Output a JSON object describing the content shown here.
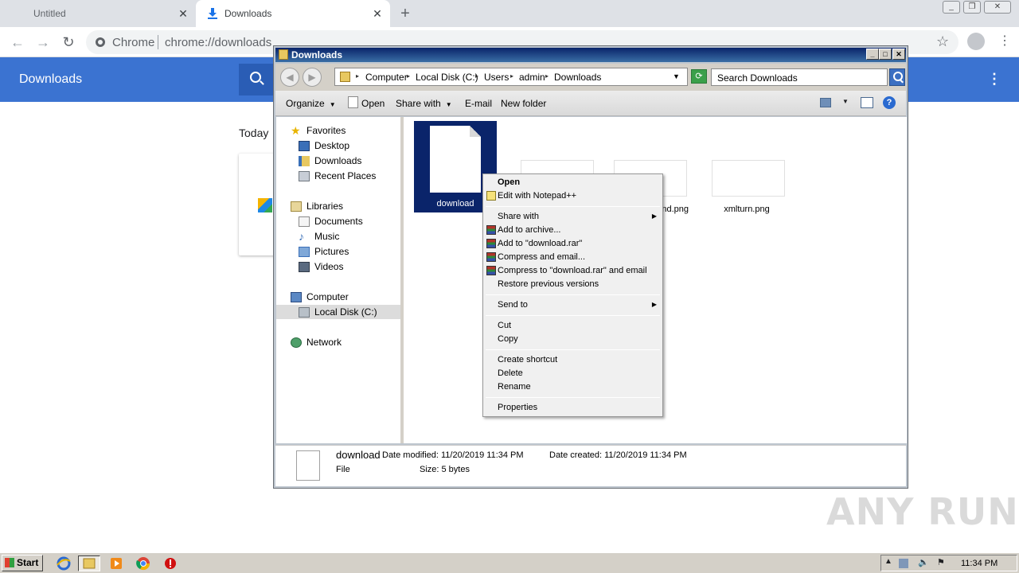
{
  "browser": {
    "tabs": [
      {
        "title": "Untitled"
      },
      {
        "title": "Downloads"
      }
    ],
    "omnibox": {
      "site": "Chrome",
      "url": "chrome://downloads"
    },
    "page": {
      "title": "Downloads",
      "date_group": "Today"
    }
  },
  "explorer": {
    "title": "Downloads",
    "breadcrumb": [
      "Computer",
      "Local Disk (C:)",
      "Users",
      "admin",
      "Downloads"
    ],
    "search_placeholder": "Search Downloads",
    "commands": {
      "organize": "Organize",
      "open": "Open",
      "share_with": "Share with",
      "email": "E-mail",
      "new_folder": "New folder"
    },
    "nav": {
      "favorites": "Favorites",
      "desktop": "Desktop",
      "downloads": "Downloads",
      "recent": "Recent Places",
      "libraries": "Libraries",
      "documents": "Documents",
      "music": "Music",
      "pictures": "Pictures",
      "videos": "Videos",
      "computer": "Computer",
      "local_disk": "Local Disk (C:)",
      "network": "Network"
    },
    "files": [
      {
        "name": "download",
        "selected": true
      },
      {
        "name": "",
        "selected": false
      },
      {
        "name": "nd.png",
        "selected": false
      },
      {
        "name": "xmlturn.png",
        "selected": false
      }
    ],
    "details": {
      "name": "download",
      "type": "File",
      "modified": "Date modified: 11/20/2019 11:34 PM",
      "created": "Date created: 11/20/2019 11:34 PM",
      "size": "Size: 5 bytes"
    }
  },
  "context_menu": {
    "open": "Open",
    "notepad": "Edit with Notepad++",
    "share_with": "Share with",
    "add_archive": "Add to archive...",
    "add_rar": "Add to \"download.rar\"",
    "compress_email": "Compress and email...",
    "compress_rar_email": "Compress to \"download.rar\" and email",
    "restore": "Restore previous versions",
    "send_to": "Send to",
    "cut": "Cut",
    "copy": "Copy",
    "create_shortcut": "Create shortcut",
    "delete": "Delete",
    "rename": "Rename",
    "properties": "Properties"
  },
  "watermark": "ANY RUN",
  "taskbar": {
    "start": "Start",
    "clock": "11:34 PM"
  },
  "colors": {
    "chrome_header": "#3b73d1",
    "xp_title": "#0a246a",
    "selection": "#0a246a"
  }
}
